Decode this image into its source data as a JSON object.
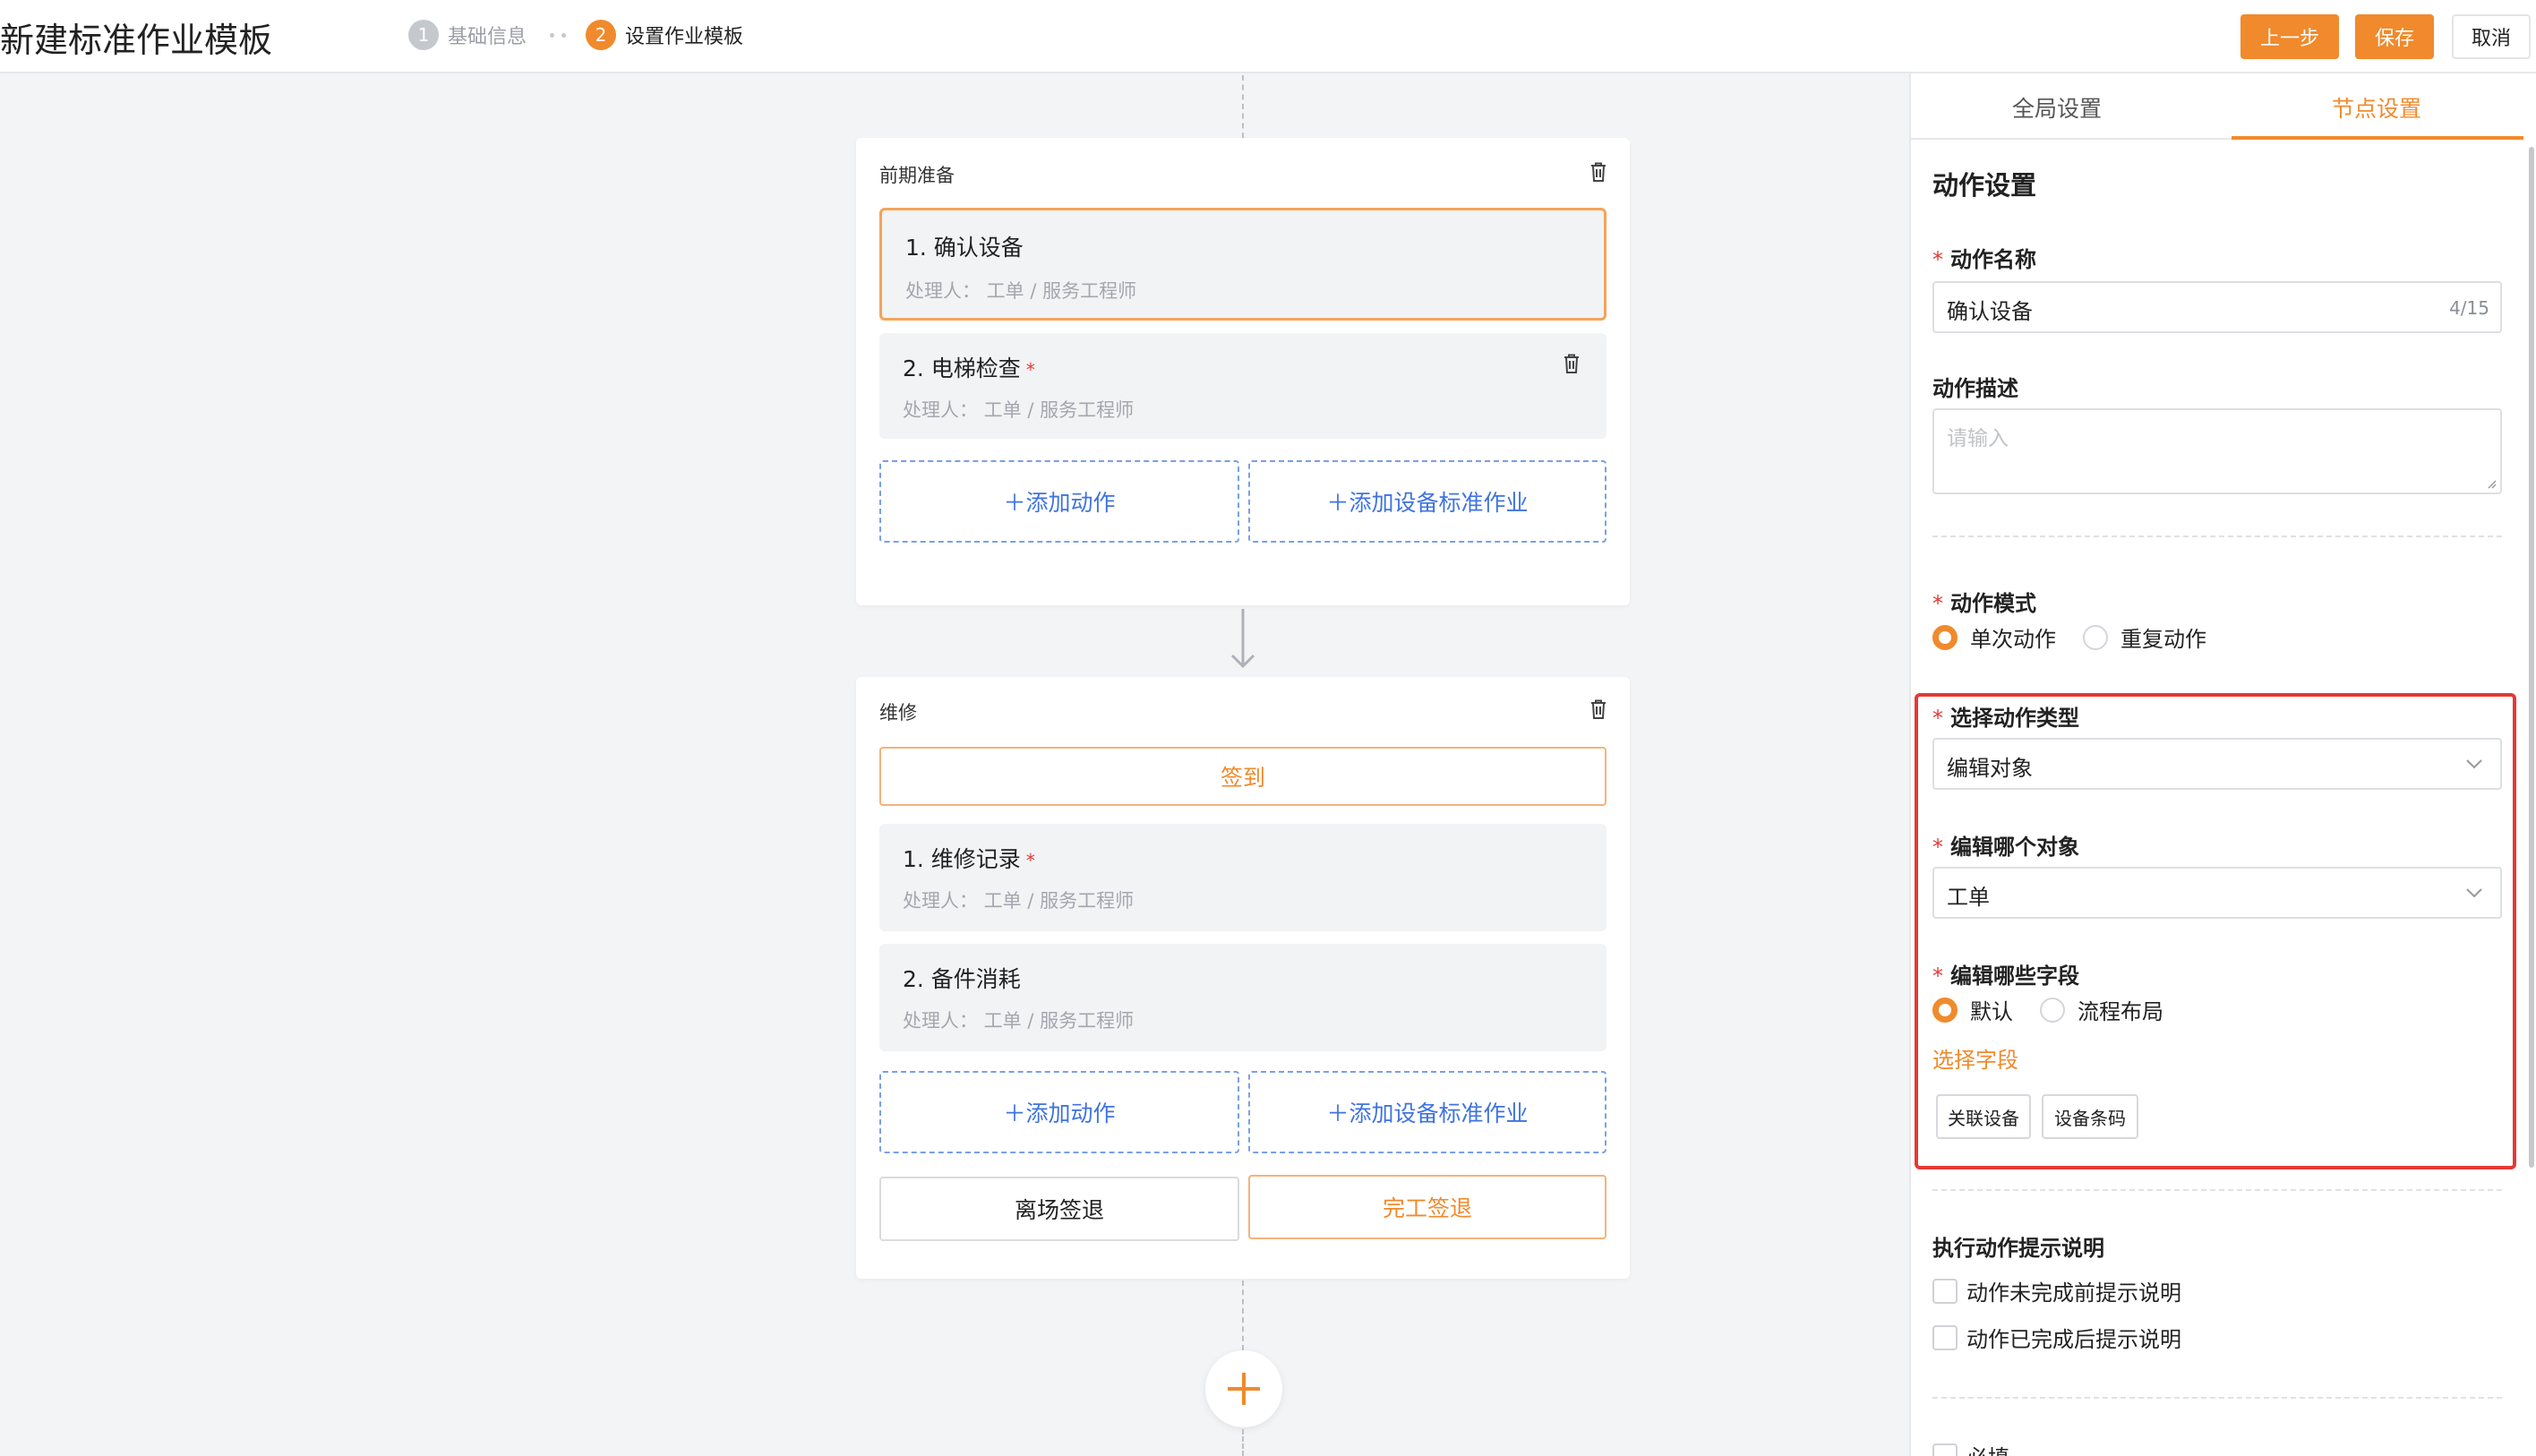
{
  "header": {
    "title": "新建标准作业模板",
    "steps": [
      {
        "num": "1",
        "label": "基础信息"
      },
      {
        "num": "2",
        "label": "设置作业模板"
      }
    ],
    "buttons": {
      "prev": "上一步",
      "save": "保存",
      "cancel": "取消"
    }
  },
  "canvas": {
    "stage1": {
      "title": "前期准备",
      "items": [
        {
          "title": "1. 确认设备",
          "required": false,
          "sub": "处理人：  工单 / 服务工程师"
        },
        {
          "title": "2. 电梯检查",
          "required": true,
          "sub": "处理人：  工单 / 服务工程师"
        }
      ],
      "add_action": "＋添加动作",
      "add_std": "＋添加设备标准作业"
    },
    "stage2": {
      "title": "维修",
      "checkin": "签到",
      "items": [
        {
          "title": "1. 维修记录",
          "required": true,
          "sub": "处理人：  工单 / 服务工程师"
        },
        {
          "title": "2. 备件消耗",
          "required": false,
          "sub": "处理人：  工单 / 服务工程师"
        }
      ],
      "add_action": "＋添加动作",
      "add_std": "＋添加设备标准作业",
      "leave": "离场签退",
      "finish": "完工签退"
    },
    "required_mark": "*"
  },
  "panel": {
    "tabs": {
      "global": "全局设置",
      "node": "节点设置"
    },
    "section_title": "动作设置",
    "name": {
      "label": "动作名称",
      "value": "确认设备",
      "count": "4/15"
    },
    "desc": {
      "label": "动作描述",
      "placeholder": "请输入"
    },
    "mode": {
      "label": "动作模式",
      "options": [
        "单次动作",
        "重复动作"
      ],
      "selected": "单次动作"
    },
    "action_type": {
      "label": "选择动作类型",
      "value": "编辑对象"
    },
    "edit_object": {
      "label": "编辑哪个对象",
      "value": "工单"
    },
    "edit_fields": {
      "label": "编辑哪些字段",
      "options": [
        "默认",
        "流程布局"
      ],
      "selected": "默认"
    },
    "select_fields_link": "选择字段",
    "tags": [
      "关联设备",
      "设备条码"
    ],
    "hint": {
      "title": "执行动作提示说明",
      "options": [
        "动作未完成前提示说明",
        "动作已完成后提示说明"
      ]
    },
    "required_checkbox": "必填",
    "star": "*"
  },
  "colors": {
    "accent": "#f08a2c",
    "link_blue": "#3f73e0",
    "highlight_red": "#e53935"
  }
}
